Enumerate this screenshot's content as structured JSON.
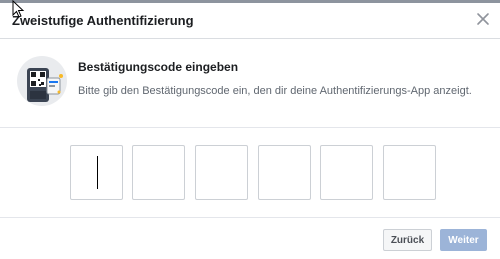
{
  "dialog": {
    "title": "Zweistufige Authentifizierung",
    "close_icon": "close-icon"
  },
  "info": {
    "illustration_icon": "qr-phone-illustration",
    "heading": "Bestätigungscode eingeben",
    "description": "Bitte gib den Bestätigungscode ein, den dir deine Authentifizierungs-App anzeigt."
  },
  "code": {
    "digits": [
      "",
      "",
      "",
      "",
      "",
      ""
    ]
  },
  "footer": {
    "back_label": "Zurück",
    "next_label": "Weiter"
  },
  "colors": {
    "primary_disabled": "#9cb4d8",
    "border": "#ccd0d5"
  }
}
